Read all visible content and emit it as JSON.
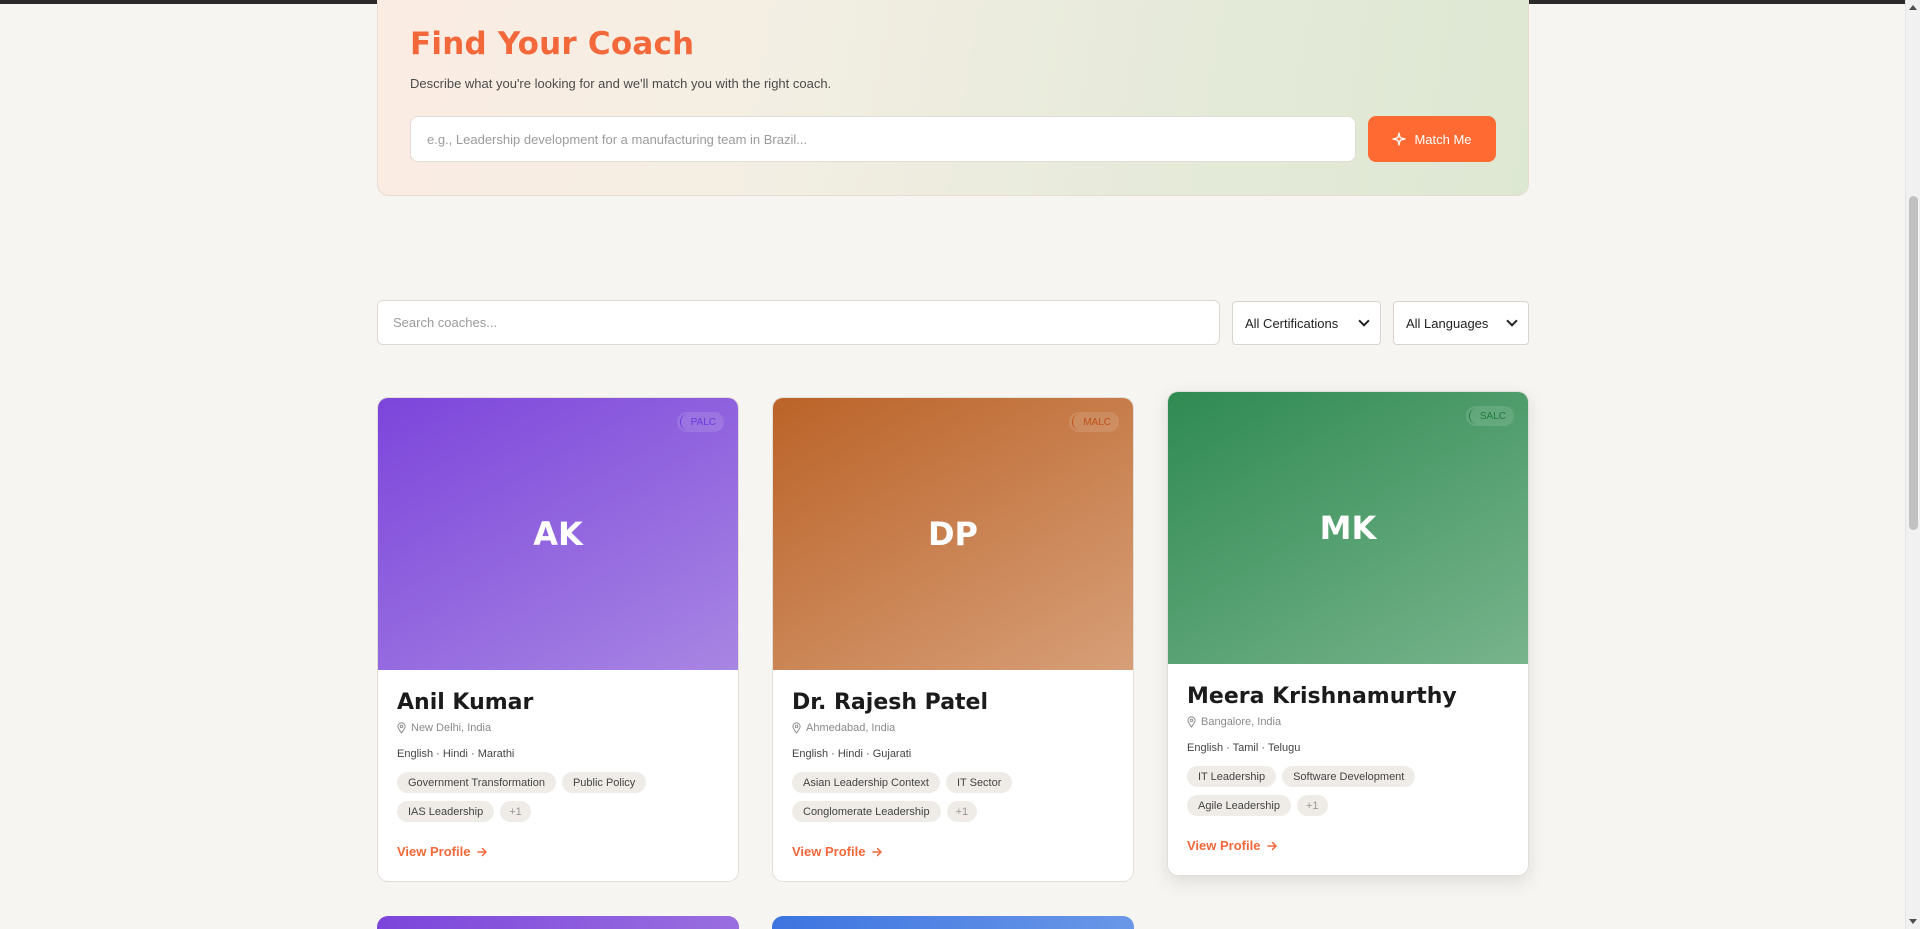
{
  "hero": {
    "title": "Find Your Coach",
    "subtitle": "Describe what you're looking for and we'll match you with the right coach.",
    "input_placeholder": "e.g., Leadership development for a manufacturing team in Brazil...",
    "match_button": "Match Me"
  },
  "filters": {
    "search_placeholder": "Search coaches...",
    "certification": "All Certifications",
    "language": "All Languages"
  },
  "coaches": [
    {
      "initials": "AK",
      "badge": "PALC",
      "name": "Anil Kumar",
      "location": "New Delhi, India",
      "languages": "English · Hindi · Marathi",
      "tags": [
        "Government Transformation",
        "Public Policy",
        "IAS Leadership"
      ],
      "more": "+1",
      "link": "View Profile",
      "colors": {
        "from": "#7c45db",
        "to": "#a886e3",
        "badge": "#6a3bd8"
      }
    },
    {
      "initials": "DP",
      "badge": "MALC",
      "name": "Dr. Rajesh Patel",
      "location": "Ahmedabad, India",
      "languages": "English · Hindi · Gujarati",
      "tags": [
        "Asian Leadership Context",
        "IT Sector",
        "Conglomerate Leadership"
      ],
      "more": "+1",
      "link": "View Profile",
      "colors": {
        "from": "#bb6328",
        "to": "#d79f78",
        "badge": "#c0521c"
      }
    },
    {
      "initials": "MK",
      "badge": "SALC",
      "name": "Meera Krishnamurthy",
      "location": "Bangalore, India",
      "languages": "English · Tamil · Telugu",
      "tags": [
        "IT Leadership",
        "Software Development",
        "Agile Leadership"
      ],
      "more": "+1",
      "link": "View Profile",
      "colors": {
        "from": "#2f8a52",
        "to": "#78b48c",
        "badge": "#217a3f"
      }
    }
  ],
  "colors": {
    "accent": "#ff6a33",
    "title": "#f2683a"
  }
}
